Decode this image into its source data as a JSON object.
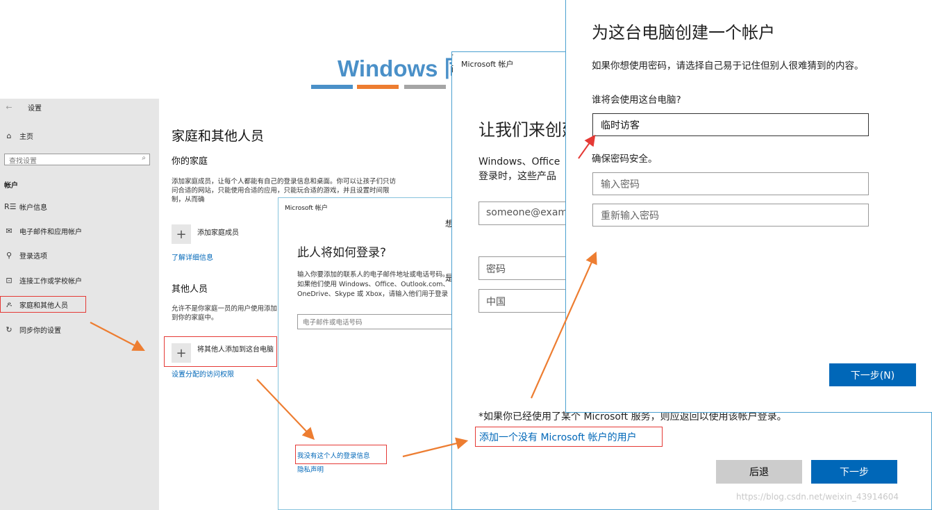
{
  "slide": {
    "title": "Windows 同",
    "colors": [
      "#4a90c8",
      "#ed7d31",
      "#a5a5a5"
    ]
  },
  "settings": {
    "back_icon": "←",
    "window_title": "设置",
    "home": "主页",
    "search_placeholder": "查找设置",
    "section": "帐户",
    "nav": [
      {
        "icon": "user-list-icon",
        "glyph": "R☰",
        "label": "帐户信息"
      },
      {
        "icon": "mail-icon",
        "glyph": "✉",
        "label": "电子邮件和应用帐户"
      },
      {
        "icon": "key-icon",
        "glyph": "⚲",
        "label": "登录选项"
      },
      {
        "icon": "briefcase-icon",
        "glyph": "⊡",
        "label": "连接工作或学校帐户"
      },
      {
        "icon": "people-icon",
        "glyph": "ዶ",
        "label": "家庭和其他人员"
      },
      {
        "icon": "sync-icon",
        "glyph": "↻",
        "label": "同步你的设置"
      }
    ],
    "page_title": "家庭和其他人员",
    "family_heading": "你的家庭",
    "family_text": "添加家庭成员，让每个人都能有自己的登录信息和桌面。你可以让孩子们只访问合适的网站，只能使用合适的应用，只能玩合适的游戏，并且设置时间限制，从而确",
    "add_family": "添加家庭成员",
    "learn_more": "了解详细信息",
    "others_heading": "其他人员",
    "others_text": "允许不是你家庭一员的用户使用添加到你的家庭中。",
    "add_other": "将其他人添加到这台电脑",
    "assigned_access": "设置分配的访问权限"
  },
  "dialog1": {
    "title": "Microsoft 帐户",
    "heading": "此人将如何登录?",
    "text": "输入你要添加的联系人的电子邮件地址或电话号码。如果他们使用 Windows、Office、Outlook.com、OneDrive、Skype 或 Xbox，请输入他们用于登录的电子邮件或电话号码。",
    "input_placeholder": "电子邮件或电话号码",
    "no_signin": "我没有这个人的登录信息",
    "privacy": "隐私声明",
    "clip_char1": "想",
    "clip_char2": "是"
  },
  "dialog2": {
    "title": "Microsoft 帐户",
    "heading": "让我们来创建你的帐户",
    "text_line1": "Windows、Office",
    "text_line2": "登录时，这些产品",
    "email_placeholder": "someone@example.com",
    "password_placeholder": "密码",
    "country": "中国",
    "footnote": "*如果你已经使用了某个 Microsoft 服务，则应返回以使用该帐户登录。",
    "add_no_msa": "添加一个没有 Microsoft 帐户的用户",
    "back": "后退",
    "next": "下一步",
    "behind_text1": "可",
    "behind_text2": "而"
  },
  "dialog3": {
    "title": "为这台电脑创建一个帐户",
    "hint": "如果你想使用密码，请选择自己易于记住但别人很难猜到的内容。",
    "who_label": "谁将会使用这台电脑?",
    "username": "临时访客",
    "secure_label": "确保密码安全。",
    "password_placeholder": "输入密码",
    "reenter_placeholder": "重新输入密码",
    "next": "下一步(N)"
  },
  "watermark": "https://blog.csdn.net/weixin_43914604"
}
